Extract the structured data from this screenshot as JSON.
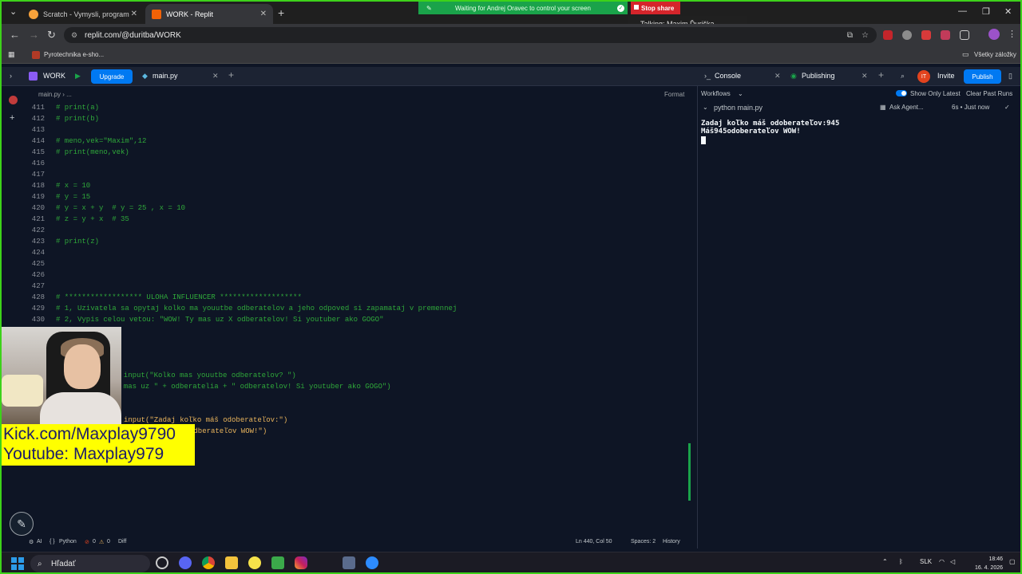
{
  "browser": {
    "tabs": [
      {
        "label": "Scratch - Vymysli, programuj, zdieľaj"
      },
      {
        "label": "WORK - Replit"
      }
    ],
    "share_banner": "Waiting for Andrej Oravec to control your screen",
    "stop_share": "Stop share",
    "talking": "Talking: Maxim Ďuriška",
    "url": "replit.com/@duritba/WORK",
    "bookmark": "Pyrotechnika e-sho...",
    "all_bookmarks": "Všetky záložky"
  },
  "replit": {
    "project": "WORK",
    "upgrade": "Upgrade",
    "file_tab": "main.py",
    "console_tab": "Console",
    "publishing_tab": "Publishing",
    "avatar": "IT",
    "invite": "Invite",
    "publish": "Publish"
  },
  "editor": {
    "breadcrumb": "main.py  ›  ...",
    "format": "Format",
    "lines": [
      {
        "n": "411",
        "text": "# print(a)",
        "kind": "comment"
      },
      {
        "n": "412",
        "text": "# print(b)",
        "kind": "comment"
      },
      {
        "n": "413",
        "text": "",
        "kind": "comment"
      },
      {
        "n": "414",
        "text": "# meno,vek=\"Maxim\",12",
        "kind": "comment"
      },
      {
        "n": "415",
        "text": "# print(meno,vek)",
        "kind": "comment"
      },
      {
        "n": "416",
        "text": "",
        "kind": "comment"
      },
      {
        "n": "417",
        "text": "",
        "kind": "comment"
      },
      {
        "n": "418",
        "text": "# x = 10",
        "kind": "comment"
      },
      {
        "n": "419",
        "text": "# y = 15",
        "kind": "comment"
      },
      {
        "n": "420",
        "text": "# y = x + y  # y = 25 , x = 10",
        "kind": "comment"
      },
      {
        "n": "421",
        "text": "# z = y + x  # 35",
        "kind": "comment"
      },
      {
        "n": "422",
        "text": "",
        "kind": "comment"
      },
      {
        "n": "423",
        "text": "# print(z)",
        "kind": "comment"
      },
      {
        "n": "424",
        "text": "",
        "kind": "comment"
      },
      {
        "n": "425",
        "text": "",
        "kind": "comment"
      },
      {
        "n": "426",
        "text": "",
        "kind": "comment"
      },
      {
        "n": "427",
        "text": "",
        "kind": "comment"
      },
      {
        "n": "428",
        "text": "# ****************** ULOHA INFLUENCER *******************",
        "kind": "comment"
      },
      {
        "n": "429",
        "text": "# 1, Uzivatela sa opytaj kolko ma youutbe odberatelov a jeho odpoved si zapamataj v premennej",
        "kind": "comment"
      },
      {
        "n": "430",
        "text": "# 2, Vypis celou vetou: \"WOW! Ty mas uz X odberatelov! Si youtuber ako GOGO\"",
        "kind": "comment"
      }
    ],
    "hidden_lines": [
      {
        "text": "  input(\"Kolko mas youutbe odberatelov? \")",
        "kind": "comment"
      },
      {
        "text": "y mas uz \" + odberatelia + \" odberatelov! Si youtuber ako GOGO\")",
        "kind": "comment"
      },
      {
        "text": "input(\"Zadaj koľko máš odoberateľov:\")",
        "kind": "str"
      },
      {
        "text": "odberateľov WOW!\")",
        "kind": "str"
      }
    ]
  },
  "console": {
    "workflows": "Workflows",
    "show_only_latest": "Show Only Latest",
    "clear_past_runs": "Clear Past Runs",
    "run_cmd": "python main.py",
    "ask_agent": "Ask Agent...",
    "run_time": "6s • Just now",
    "output": [
      "Zadaj koľko máš odoberateľov:945",
      "Máš945odoberateľov WOW!"
    ]
  },
  "statusbar": {
    "ai": "AI",
    "language": "Python",
    "errors": "0",
    "warnings": "0",
    "diff": "Diff",
    "position": "Ln 440, Col 50",
    "spaces": "Spaces: 2",
    "history": "History"
  },
  "overlay": {
    "promo_line1": "Kick.com/Maxplay9790",
    "promo_line2": "Youtube: Maxplay979"
  },
  "taskbar": {
    "search": "Hľadať",
    "lang": "SLK",
    "time": "18:46",
    "date": "16. 4. 2026"
  }
}
